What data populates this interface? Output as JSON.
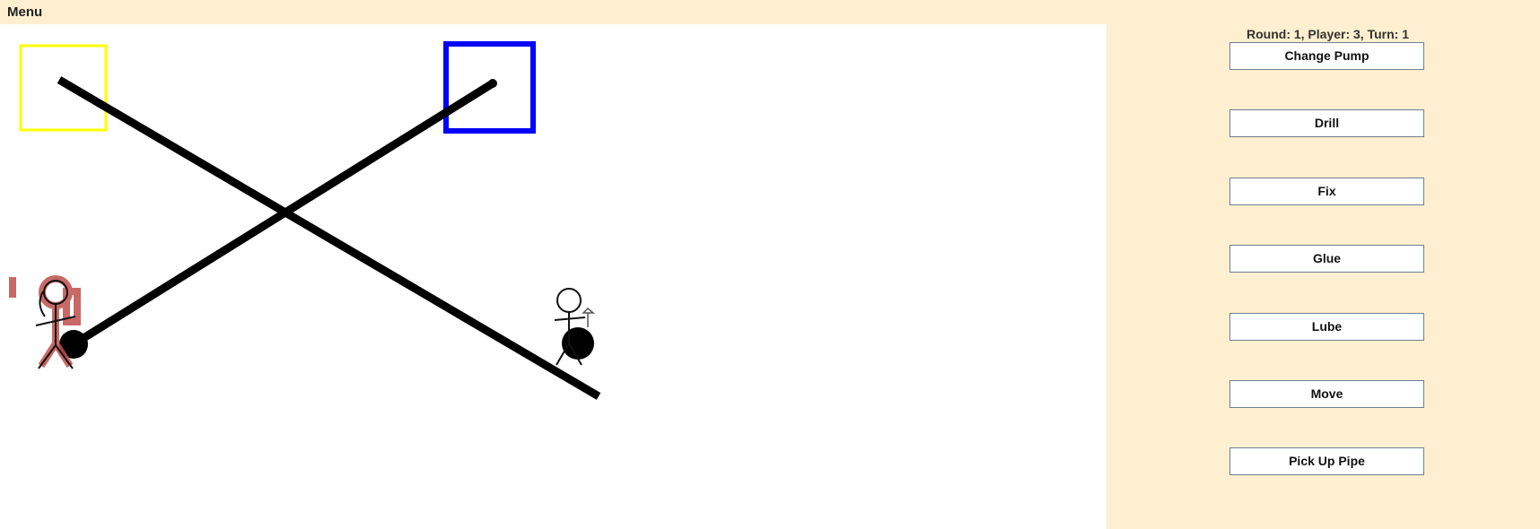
{
  "menu": {
    "label": "Menu"
  },
  "status": {
    "text": "Round: 1, Player: 3, Turn: 1"
  },
  "actions": [
    {
      "label": "Change Pump"
    },
    {
      "label": "Drill"
    },
    {
      "label": "Fix"
    },
    {
      "label": "Glue"
    },
    {
      "label": "Lube"
    },
    {
      "label": "Move"
    },
    {
      "label": "Pick Up Pipe"
    }
  ],
  "board": {
    "sources": [
      {
        "name": "yellow-source",
        "color": "#ffff00"
      },
      {
        "name": "blue-source",
        "color": "#0000ff"
      }
    ],
    "pipe_color": "#000000",
    "active_player_highlight": "#c0504d",
    "players": [
      {
        "name": "player-highlighted",
        "highlighted": true
      },
      {
        "name": "player-plain",
        "highlighted": false
      }
    ]
  }
}
